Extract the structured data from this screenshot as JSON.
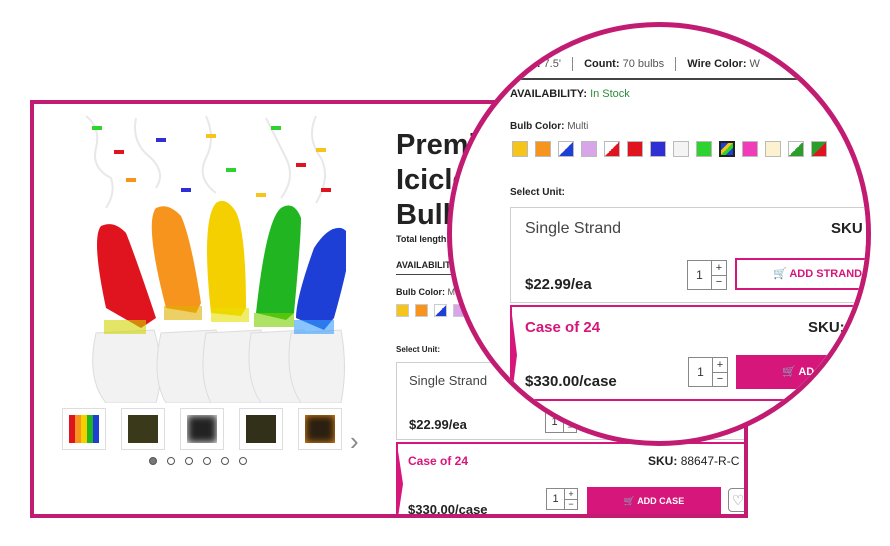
{
  "product": {
    "title_lines": [
      "Premi",
      "Icicle",
      "Bulb"
    ],
    "total_length_label": "Total length:",
    "availability_label": "AVAILABILITY:",
    "bulb_color_label": "Bulb Color:",
    "bulb_color_value_short": "Mu",
    "select_unit_label": "Select Unit:"
  },
  "units": [
    {
      "name": "Single Strand",
      "price": "$22.99/ea",
      "sku_label": "SKU",
      "qty": "1",
      "button": "ADD STRAND"
    },
    {
      "name": "Case of 24",
      "price": "$330.00/case",
      "sku_label": "SKU:",
      "sku": "88647-R-C",
      "qty": "1",
      "button": "ADD CASE"
    }
  ],
  "specs": {
    "length_label": "ngth:",
    "length_value": "7.5'",
    "count_label": "Count:",
    "count_value": "70 bulbs",
    "wire_label": "Wire Color:",
    "wire_value": "W"
  },
  "availability": {
    "label": "AVAILABILITY:",
    "value": "In Stock"
  },
  "bulb_color": {
    "label": "Bulb Color:",
    "value": "Multi"
  },
  "swatch_colors": [
    "#f5c51b",
    "#f7941d",
    "split:#1d3fd6",
    "#d8a6e8",
    "split:#e0141e",
    "#e0141e",
    "#2f2fd6",
    "#f4f4f4",
    "#2fd22f",
    "selected:multi",
    "#f03cb8",
    "#fdf2d0",
    "split:#2a9d2a",
    "split:#2a9d2a/#e0141e"
  ],
  "icons": {
    "cart": "cart-icon",
    "heart": "heart-icon",
    "next": "chevron-right-icon"
  },
  "accent_color": "#d6167a",
  "gallery": {
    "thumb_count": 5,
    "dot_count": 6,
    "active_dot": 0
  }
}
